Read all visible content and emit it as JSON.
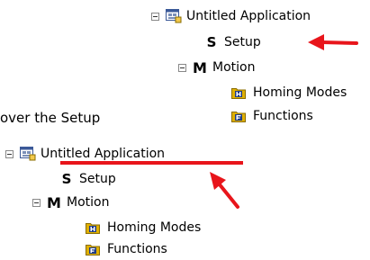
{
  "caption": "over the Setup",
  "tree_top": {
    "root_label": "Untitled Application",
    "setup_icon": "S",
    "setup_label": "Setup",
    "motion_icon": "M",
    "motion_label": "Motion",
    "homing_label": "Homing Modes",
    "functions_label": "Functions"
  },
  "tree_bottom": {
    "root_label": "Untitled Application",
    "setup_icon": "S",
    "setup_label": "Setup",
    "motion_icon": "M",
    "motion_label": "Motion",
    "homing_label": "Homing Modes",
    "functions_label": "Functions"
  },
  "icons": {
    "expand_toggle": "collapse-box-icon",
    "application": "application-icon",
    "setup": "setup-icon",
    "motion": "motion-icon",
    "homing": "homing-folder-icon",
    "functions": "functions-folder-icon"
  },
  "colors": {
    "annotation": "#e8151b",
    "folder": "#e0b000",
    "folder_letter": "#1f3c88"
  }
}
